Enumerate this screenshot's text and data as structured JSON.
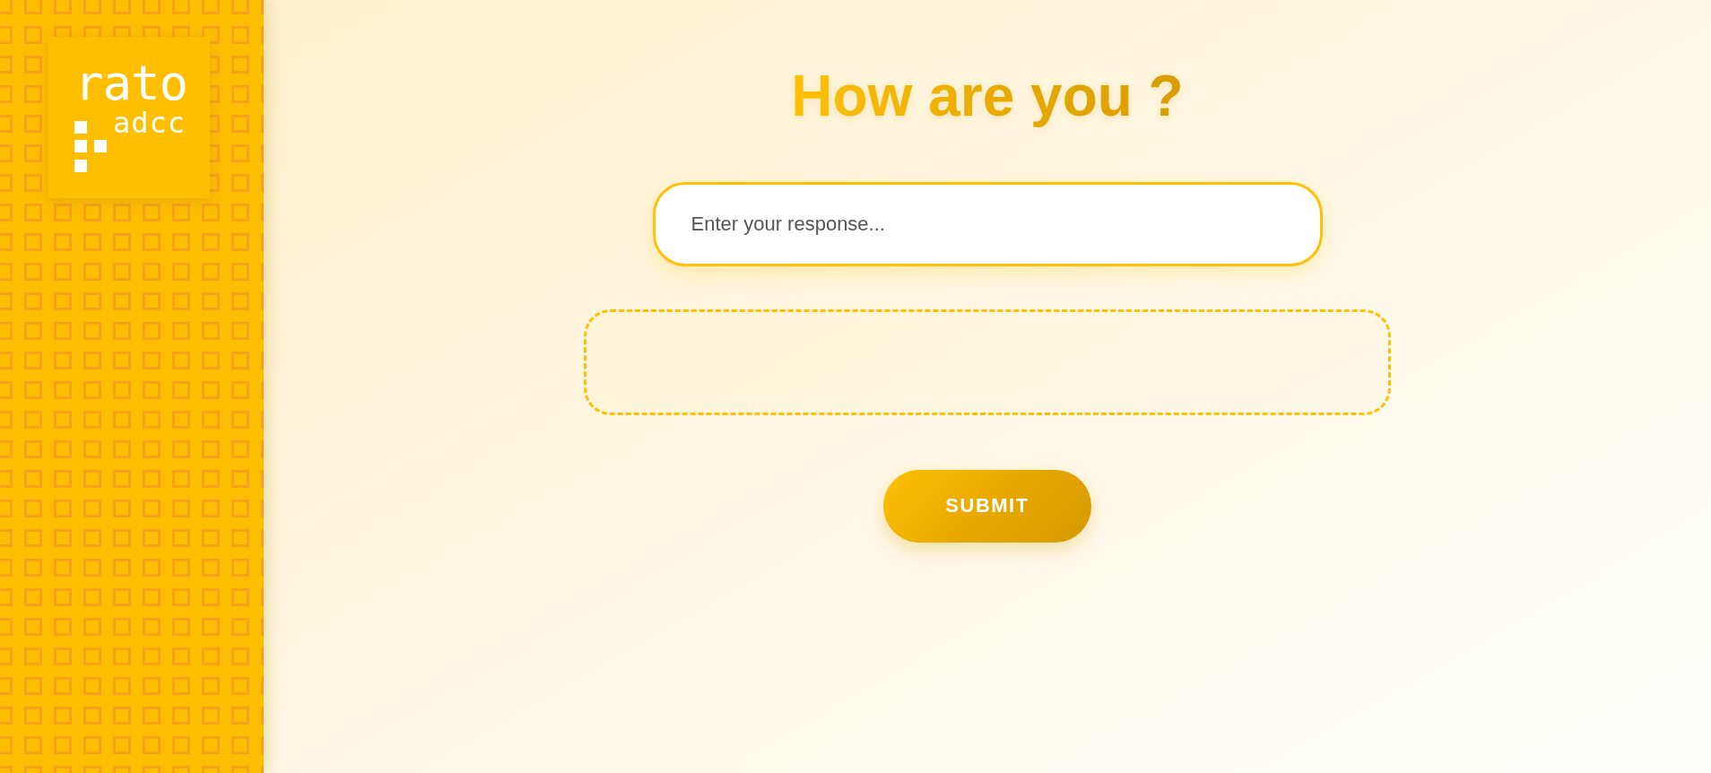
{
  "sidebar": {
    "logo": {
      "title": "rato",
      "subtitle": "adcc"
    }
  },
  "main": {
    "heading": "How are you ?",
    "response_input": {
      "placeholder": "Enter your response..."
    },
    "submit_button": {
      "label": "SUBMIT"
    }
  }
}
